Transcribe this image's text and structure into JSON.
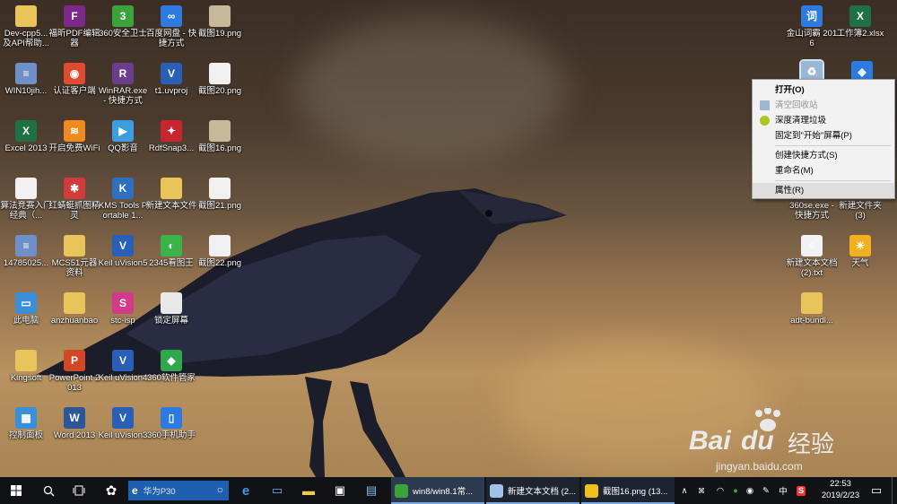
{
  "desktop": {
    "icons": [
      {
        "label": "Dev-cpp5... 及API帮助...",
        "icon": "folder-icon",
        "color": "#e9c45a",
        "glyph": ""
      },
      {
        "label": "福昕PDF编辑器",
        "icon": "pdf-editor-icon",
        "color": "#7b2a8c",
        "glyph": "F"
      },
      {
        "label": "360安全卫士",
        "icon": "360-safe-icon",
        "color": "#3aa33a",
        "glyph": "3"
      },
      {
        "label": "百度网盘 - 快捷方式",
        "icon": "baidu-netdisk-icon",
        "color": "#2d7be0",
        "glyph": "∞"
      },
      {
        "label": "截图19.png",
        "icon": "image-file-icon",
        "color": "#c8b89a",
        "glyph": ""
      },
      {
        "label": "WIN10jih...",
        "icon": "archive-icon",
        "color": "#6f8fc9",
        "glyph": "≡"
      },
      {
        "label": "认证客户端",
        "icon": "auth-client-icon",
        "color": "#e04a2e",
        "glyph": "◉"
      },
      {
        "label": "WinRAR.exe - 快捷方式",
        "icon": "winrar-icon",
        "color": "#6a3d8f",
        "glyph": "R"
      },
      {
        "label": "t1.uvproj",
        "icon": "keil-project-icon",
        "color": "#2a5fb8",
        "glyph": "V"
      },
      {
        "label": "截图20.png",
        "icon": "image-file-icon",
        "color": "#f0f0f0",
        "glyph": ""
      },
      {
        "label": "Excel 2013",
        "icon": "excel-icon",
        "color": "#1e7145",
        "glyph": "X"
      },
      {
        "label": "开启免费WiFi",
        "icon": "wifi-icon",
        "color": "#f0891e",
        "glyph": "≋"
      },
      {
        "label": "QQ影音",
        "icon": "qq-player-icon",
        "color": "#3a9ee0",
        "glyph": "▶"
      },
      {
        "label": "RdfSnap3...",
        "icon": "rdfsnap-icon",
        "color": "#c7262f",
        "glyph": "✦"
      },
      {
        "label": "截图16.png",
        "icon": "image-file-icon",
        "color": "#c8b89a",
        "glyph": ""
      },
      {
        "label": "算法竞赛入门经典（...",
        "icon": "book-icon",
        "color": "#f2f2f2",
        "glyph": ""
      },
      {
        "label": "红蜻蜓抓图精灵",
        "icon": "dragonfly-icon",
        "color": "#d23b3b",
        "glyph": "✱"
      },
      {
        "label": "KMS Tools Portable 1...",
        "icon": "kms-tools-icon",
        "color": "#2f6fc0",
        "glyph": "K"
      },
      {
        "label": "新建文本文件",
        "icon": "folder-icon",
        "color": "#e9c45a",
        "glyph": ""
      },
      {
        "label": "截图21.png",
        "icon": "image-file-icon",
        "color": "#f0f0f0",
        "glyph": ""
      },
      {
        "label": "14785025...",
        "icon": "archive-icon",
        "color": "#6f8fc9",
        "glyph": "≡"
      },
      {
        "label": "MCS51元器资料",
        "icon": "folder-icon",
        "color": "#e9c45a",
        "glyph": ""
      },
      {
        "label": "Keil uVision5",
        "icon": "keil-icon",
        "color": "#2a5fb8",
        "glyph": "V"
      },
      {
        "label": "2345看图王",
        "icon": "image-viewer-icon",
        "color": "#3ab44a",
        "glyph": "◐"
      },
      {
        "label": "截图22.png",
        "icon": "image-file-icon",
        "color": "#f0f0f0",
        "glyph": ""
      },
      {
        "label": "此电脑",
        "icon": "computer-icon",
        "color": "#3a8fd9",
        "glyph": "▭"
      },
      {
        "label": "anzhuanbao",
        "icon": "folder-icon",
        "color": "#e9c45a",
        "glyph": ""
      },
      {
        "label": "stc-isp",
        "icon": "stc-isp-icon",
        "color": "#d23b8a",
        "glyph": "S"
      },
      {
        "label": "锁定屏幕",
        "icon": "lock-screen-icon",
        "color": "#e8e8e8",
        "glyph": ""
      },
      {
        "label": "Kingsoft",
        "icon": "folder-icon",
        "color": "#e9c45a",
        "glyph": ""
      },
      {
        "label": "PowerPoint 2013",
        "icon": "powerpoint-icon",
        "color": "#d24726",
        "glyph": "P"
      },
      {
        "label": "Keil uVision4",
        "icon": "keil-icon",
        "color": "#2a5fb8",
        "glyph": "V"
      },
      {
        "label": "360软件管家",
        "icon": "360-software-icon",
        "color": "#2ea84a",
        "glyph": "◆"
      },
      {
        "label": "控制面板",
        "icon": "control-panel-icon",
        "color": "#3a8fd9",
        "glyph": "▦"
      },
      {
        "label": "Word 2013",
        "icon": "word-icon",
        "color": "#2b579a",
        "glyph": "W"
      },
      {
        "label": "Keil uVision3",
        "icon": "keil-icon",
        "color": "#2a5fb8",
        "glyph": "V"
      },
      {
        "label": "360手机助手",
        "icon": "360-phone-icon",
        "color": "#2d7be0",
        "glyph": "▯"
      },
      {
        "label": "金山词霸 2016",
        "icon": "kingsoft-dict-icon",
        "color": "#2d7be0",
        "glyph": "词"
      },
      {
        "label": "工作簿2.xlsx",
        "icon": "excel-file-icon",
        "color": "#1e7145",
        "glyph": "X"
      },
      {
        "label": "",
        "icon": "recycle-bin-icon",
        "color": "#9bb7d4",
        "glyph": "♻"
      },
      {
        "label": "",
        "icon": "box-icon",
        "color": "#2d7be0",
        "glyph": "◈"
      },
      {
        "label": "360se.exe - 快捷方式",
        "icon": "360se-icon",
        "color": "#3aa33a",
        "glyph": ""
      },
      {
        "label": "新建文件夹 (3)",
        "icon": "folder-icon",
        "color": "#e9c45a",
        "glyph": ""
      },
      {
        "label": "新建文本文档 (2).txt",
        "icon": "text-file-icon",
        "color": "#f2f2f2",
        "glyph": "≡"
      },
      {
        "label": "天气",
        "icon": "weather-icon",
        "color": "#f0b020",
        "glyph": "☀"
      },
      {
        "label": "adt-bundl...",
        "icon": "folder-icon",
        "color": "#e9c45a",
        "glyph": ""
      }
    ]
  },
  "context_menu": {
    "items": [
      {
        "label": "打开(O)",
        "bold": true,
        "disabled": false,
        "highlight": false,
        "icon": ""
      },
      {
        "label": "清空回收站",
        "bold": false,
        "disabled": true,
        "highlight": false,
        "icon": "recycle-small-icon"
      },
      {
        "label": "深度清理垃圾",
        "bold": false,
        "disabled": false,
        "highlight": false,
        "icon": "360-clean-icon"
      },
      {
        "label": "固定到\"开始\"屏幕(P)",
        "bold": false,
        "disabled": false,
        "highlight": false,
        "icon": ""
      },
      {
        "sep": true
      },
      {
        "label": "创建快捷方式(S)",
        "bold": false,
        "disabled": false,
        "highlight": false,
        "icon": ""
      },
      {
        "label": "重命名(M)",
        "bold": false,
        "disabled": false,
        "highlight": false,
        "icon": ""
      },
      {
        "sep": true
      },
      {
        "label": "属性(R)",
        "bold": false,
        "disabled": false,
        "highlight": true,
        "icon": ""
      }
    ]
  },
  "taskbar": {
    "search_placeholder": "华为P30",
    "tasks": [
      {
        "label": "win8/win8.1常...",
        "icon": "360-browser-icon",
        "color": "#3aa33a"
      },
      {
        "label": "新建文本文档 (2...",
        "icon": "notepad-icon",
        "color": "#9fc3e8"
      },
      {
        "label": "截图16.png (13...",
        "icon": "image-viewer-icon",
        "color": "#f0c020"
      }
    ],
    "input_method": "中",
    "clock_time": "22:53",
    "clock_date": "2019/2/23"
  },
  "watermark": {
    "brand": "Bai",
    "brand2": "du",
    "suffix": "经验",
    "url": "jingyan.baidu.com"
  }
}
